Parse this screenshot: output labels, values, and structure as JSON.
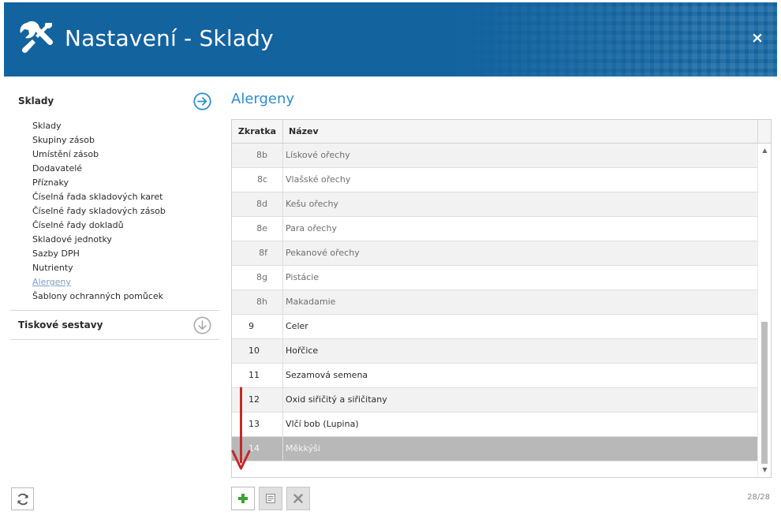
{
  "header": {
    "title": "Nastavení - Sklady",
    "close_label": "×",
    "icon": "wrench-screwdriver-icon",
    "color": "#13639f"
  },
  "sidebar": {
    "section1_label": "Sklady",
    "items": [
      {
        "label": "Sklady"
      },
      {
        "label": "Skupiny zásob"
      },
      {
        "label": "Umístění zásob"
      },
      {
        "label": "Dodavatelé"
      },
      {
        "label": "Příznaky"
      },
      {
        "label": "Číselná řada skladových karet"
      },
      {
        "label": "Číselné řady skladových zásob"
      },
      {
        "label": "Číselné řady dokladů"
      },
      {
        "label": "Skladové jednotky"
      },
      {
        "label": "Sazby DPH"
      },
      {
        "label": "Nutrienty"
      },
      {
        "label": "Alergeny",
        "active": true
      },
      {
        "label": "Šablony ochranných pomůcek"
      }
    ],
    "section2_label": "Tiskové sestavy"
  },
  "main": {
    "title": "Alergeny",
    "columns": [
      "Zkratka",
      "Název"
    ],
    "rows": [
      {
        "code": "8b",
        "name": "Lískové ořechy",
        "style": "grp alt"
      },
      {
        "code": "8c",
        "name": "Vlašské ořechy",
        "style": "grp"
      },
      {
        "code": "8d",
        "name": "Kešu ořechy",
        "style": "grp alt"
      },
      {
        "code": "8e",
        "name": "Para ořechy",
        "style": "grp"
      },
      {
        "code": "8f",
        "name": "Pekanové ořechy",
        "style": "grp alt"
      },
      {
        "code": "8g",
        "name": "Pistácie",
        "style": "grp"
      },
      {
        "code": "8h",
        "name": "Makadamie",
        "style": "grp alt"
      },
      {
        "code": "9",
        "name": "Celer",
        "style": "top"
      },
      {
        "code": "10",
        "name": "Hořčice",
        "style": "top alt"
      },
      {
        "code": "11",
        "name": "Sezamová semena",
        "style": "top"
      },
      {
        "code": "12",
        "name": "Oxid siřičitý a siřičitany",
        "style": "top alt"
      },
      {
        "code": "13",
        "name": "Vlčí bob (Lupina)",
        "style": "top"
      },
      {
        "code": "14",
        "name": "Měkkýši",
        "style": "top sel"
      }
    ],
    "counter": "28/28"
  },
  "colors": {
    "accent": "#2c8dce",
    "selected_row": "#b8b8b8",
    "annotation_arrow": "#c62828",
    "add_icon": "#3aa335"
  }
}
